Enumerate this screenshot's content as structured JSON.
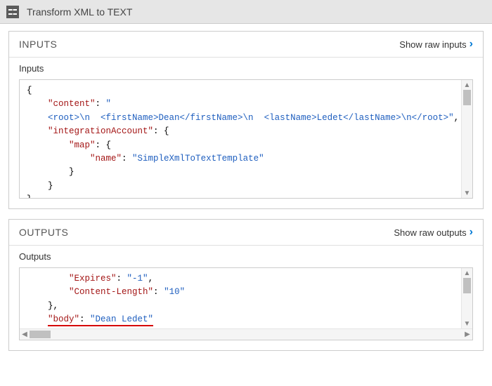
{
  "title": "Transform XML to TEXT",
  "inputs": {
    "panel_title": "INPUTS",
    "show_raw_label": "Show raw inputs",
    "section_label": "Inputs",
    "code": {
      "line1": "{",
      "key_content": "\"content\"",
      "colon": ": ",
      "content_open": "\"",
      "content_body": "<root>\\n  <firstName>Dean</firstName>\\n  <lastName>Ledet</lastName>\\n</root>\"",
      "comma": ",",
      "key_integration": "\"integrationAccount\"",
      "obj_open": ": {",
      "key_map": "\"map\"",
      "map_open": ": {",
      "key_name": "\"name\"",
      "name_val": "\"SimpleXmlToTextTemplate\"",
      "close1": "}",
      "close2": "}",
      "close3": "}"
    }
  },
  "outputs": {
    "panel_title": "OUTPUTS",
    "show_raw_label": "Show raw outputs",
    "section_label": "Outputs",
    "code": {
      "key_expires": "\"Expires\"",
      "val_expires": "\"-1\"",
      "key_clen": "\"Content-Length\"",
      "val_clen": "\"10\"",
      "close_hdr": "},",
      "key_body": "\"body\"",
      "val_body": "\"Dean Ledet\"",
      "close_root": "}"
    }
  }
}
